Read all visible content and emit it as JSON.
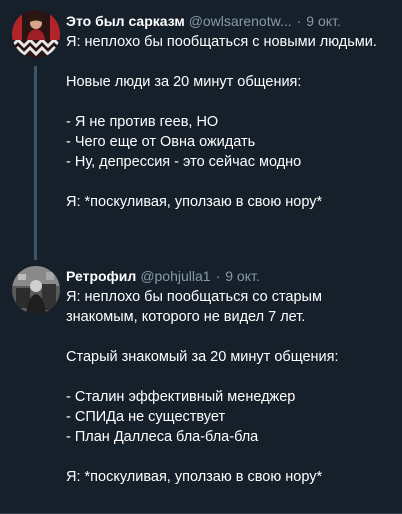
{
  "tweets": [
    {
      "author_name": "Это был сарказм",
      "handle": "@owlsarenotw...",
      "separator": "·",
      "date": "9 окт.",
      "lines": [
        "Я: неплохо бы пообщаться с новыми людьми.",
        "",
        "Новые люди за 20 минут общения:",
        "",
        "- Я не против геев, НО",
        "- Чего еще от Овна ожидать",
        "- Ну, депрессия - это сейчас модно",
        "",
        "Я: *поскуливая, уползаю в свою нору*"
      ]
    },
    {
      "author_name": "Ретрофил",
      "handle": "@pohjulla1",
      "separator": "·",
      "date": "9 окт.",
      "lines": [
        "Я: неплохо бы пообщаться со старым",
        "знакомым, которого не видел 7 лет.",
        "",
        "Старый знакомый за 20 минут общения:",
        "",
        "- Сталин эффективный менеджер",
        "- СПИДа не существует",
        "- План Даллеса бла-бла-бла",
        "",
        "Я: *поскуливая, уползаю в свою нору*"
      ]
    }
  ],
  "colors": {
    "background": "#15202b",
    "secondary_text": "#8899a6",
    "thread_line": "#3d5466"
  }
}
